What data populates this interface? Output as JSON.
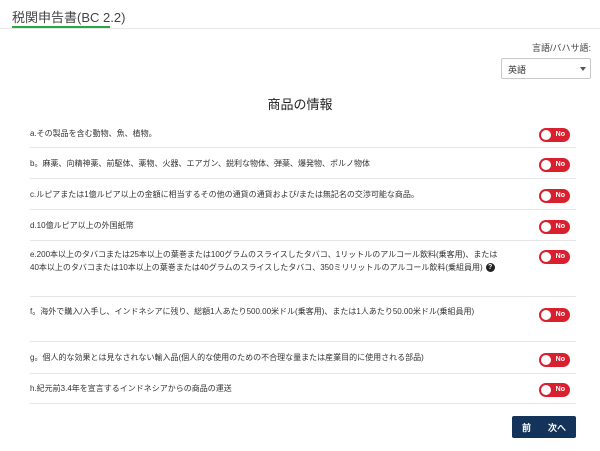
{
  "header": {
    "title": "税関申告書(BC 2.2)"
  },
  "language": {
    "label": "言語/バハサ語:",
    "selected": "英語"
  },
  "section_title": "商品の情報",
  "items": [
    {
      "text": "a.その製品を含む動物、魚、植物。",
      "toggle": "No"
    },
    {
      "text": "b。麻薬、向精神薬、前駆体、薬物、火器、エアガン、鋭利な物体、弾薬、爆発物、ポルノ物体",
      "toggle": "No"
    },
    {
      "text": "c.ルピアまたは1億ルピア以上の金額に相当するその他の通貨の通貨および/または無記名の交渉可能な商品。",
      "toggle": "No"
    },
    {
      "text": "d.10億ルピア以上の外国紙幣",
      "toggle": "No"
    },
    {
      "text": "e.200本以上のタバコまたは25本以上の葉巻または100グラムのスライスしたタバコ、1リットルのアルコール飲料(乗客用)、または40本以上のタバコまたは10本以上の葉巻または40グラムのスライスしたタバコ、350ミリリットルのアルコール飲料(乗組員用)",
      "toggle": "No",
      "help": "?"
    },
    {
      "text": "f。海外で購入/入手し、インドネシアに残り、総額1人あたり500.00米ドル(乗客用)、または1人あたり50.00米ドル(乗組員用)",
      "toggle": "No"
    },
    {
      "text": "g。個人的な効果とは見なされない輸入品(個人的な使用のための不合理な量または産業目的に使用される部品)",
      "toggle": "No"
    },
    {
      "text": "h.紀元前3.4年を宣言するインドネシアからの商品の運送",
      "toggle": "No"
    }
  ],
  "footer": {
    "prev_label": "前",
    "next_label": "次へ"
  }
}
